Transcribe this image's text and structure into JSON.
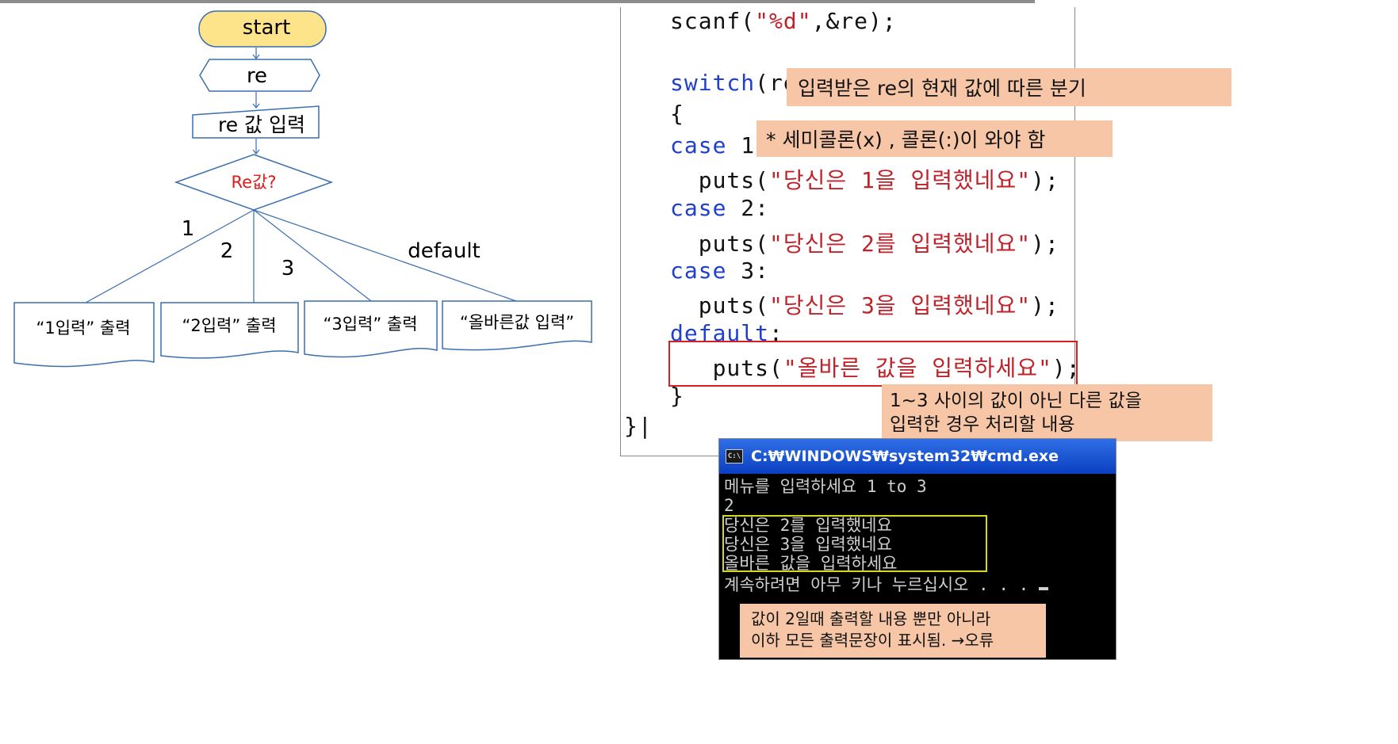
{
  "flowchart": {
    "start": "start",
    "var": "re",
    "input": "re 값 입력",
    "decision": "Re값?",
    "branch_labels": [
      "1",
      "2",
      "3",
      "default"
    ],
    "outputs": [
      "“1입력” 출력",
      "“2입력” 출력",
      "“3입력” 출력",
      "“올바른값 입력”"
    ],
    "colors": {
      "terminator_fill": "#fde38a",
      "line": "#3b6fb0",
      "decision_text": "#e01a1a"
    }
  },
  "code": {
    "lines": [
      [
        {
          "t": "scanf("
        },
        {
          "t": "\"%d\"",
          "c": "str"
        },
        {
          "t": ",&re);"
        }
      ],
      [],
      [
        {
          "t": "switch",
          "c": "kw"
        },
        {
          "t": "(re)"
        }
      ],
      [
        {
          "t": "{"
        }
      ],
      [
        {
          "t": "case",
          "c": "kw"
        },
        {
          "t": " 1:"
        }
      ],
      [
        {
          "t": "  puts("
        },
        {
          "t": "\"당신은 1을 입력했네요\"",
          "c": "str"
        },
        {
          "t": ");"
        }
      ],
      [
        {
          "t": "case",
          "c": "kw"
        },
        {
          "t": " 2:"
        }
      ],
      [
        {
          "t": "  puts("
        },
        {
          "t": "\"당신은 2를 입력했네요\"",
          "c": "str"
        },
        {
          "t": ");"
        }
      ],
      [
        {
          "t": "case",
          "c": "kw"
        },
        {
          "t": " 3:"
        }
      ],
      [
        {
          "t": "  puts("
        },
        {
          "t": "\"당신은 3을 입력했네요\"",
          "c": "str"
        },
        {
          "t": ");"
        }
      ],
      [
        {
          "t": "default",
          "c": "kw"
        },
        {
          "t": ":"
        }
      ],
      [
        {
          "t": "   puts("
        },
        {
          "t": "\"올바른 값을 입력하세요\"",
          "c": "str"
        },
        {
          "t": ");"
        }
      ],
      [
        {
          "t": "}"
        }
      ],
      [
        {
          "t": "}|"
        }
      ]
    ]
  },
  "notes": {
    "switch": "입력받은 re의 현재 값에 따른 분기",
    "colon": "* 세미콜론(x) , 콜론(:)이 와야 함",
    "default": "1~3 사이의 값이 아닌 다른 값을\n입력한 경우 처리할 내용"
  },
  "cmd": {
    "title": "C:₩WINDOWS₩system32₩cmd.exe",
    "icon": "C:\\",
    "lines": [
      "메뉴를 입력하세요 1 to 3",
      "2",
      "당신은 2를 입력했네요",
      "당신은 3을 입력했네요",
      "올바른 값을 입력하세요",
      "계속하려면 아무 키나 누르십시오 . . ."
    ],
    "note": "값이 2일때 출력할 내용 뿐만 아니라\n이하 모든 출력문장이 표시됨. →오류"
  },
  "colors": {
    "keyword": "#1f3fd0",
    "string": "#c0222a",
    "note_bg": "#f6c6a6",
    "highlight_red": "#d42020",
    "highlight_yellow": "#d8d820"
  }
}
